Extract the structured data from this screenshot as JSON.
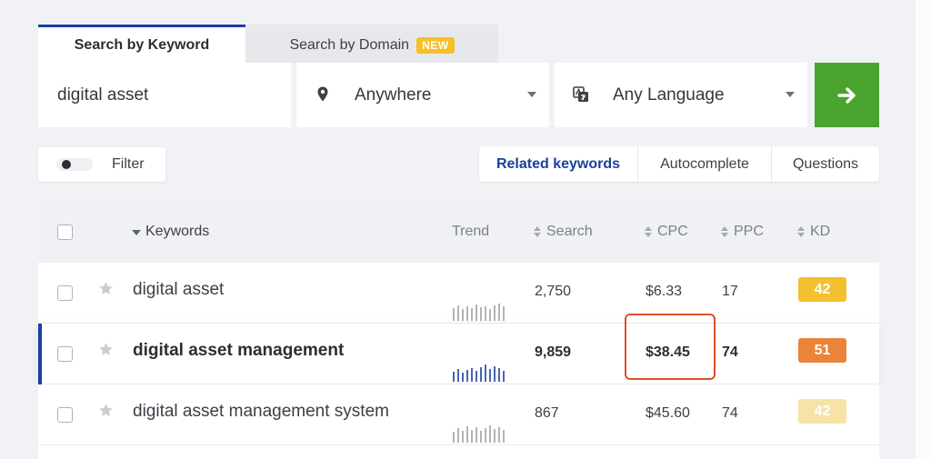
{
  "tabs": [
    {
      "label": "Search by Keyword",
      "active": true
    },
    {
      "label": "Search by Domain",
      "badge": "NEW",
      "active": false
    }
  ],
  "search": {
    "keyword_value": "digital asset",
    "location_value": "Anywhere",
    "language_value": "Any Language",
    "location_icon": "location-pin-icon",
    "language_icon": "translate-icon",
    "submit_icon": "arrow-right-icon"
  },
  "filter": {
    "label": "Filter",
    "enabled": false
  },
  "segment_tabs": [
    {
      "label": "Related keywords",
      "active": true
    },
    {
      "label": "Autocomplete",
      "active": false
    },
    {
      "label": "Questions",
      "active": false
    }
  ],
  "table": {
    "headers": {
      "keywords": "Keywords",
      "trend": "Trend",
      "search": "Search",
      "cpc": "CPC",
      "ppc": "PPC",
      "kd": "KD"
    },
    "rows": [
      {
        "keyword": "digital asset",
        "search": "2,750",
        "cpc": "$6.33",
        "ppc": "17",
        "kd": "42",
        "kd_color": "#f4c02f"
      },
      {
        "keyword": "digital asset management",
        "search": "9,859",
        "cpc": "$38.45",
        "ppc": "74",
        "kd": "51",
        "kd_color": "#e9843a"
      },
      {
        "keyword": "digital asset management system",
        "search": "867",
        "cpc": "$45.60",
        "ppc": "74",
        "kd": "42",
        "kd_color": "#f7e3a6"
      }
    ]
  },
  "colors": {
    "accent": "#1a3f9d",
    "go_button": "#4aa32f",
    "callout": "#e14d2a",
    "badge_new": "#f6c026"
  }
}
